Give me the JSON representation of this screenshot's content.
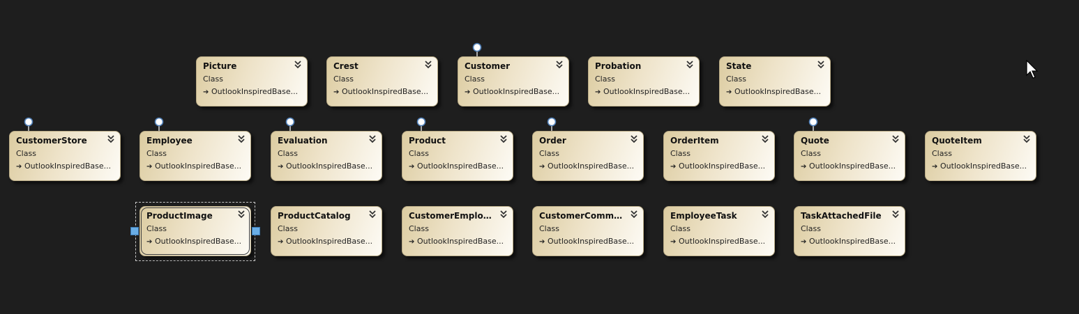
{
  "diagram": {
    "shapes": [
      {
        "name": "Picture",
        "kind": "Class",
        "base": "OutlookInspiredBase...",
        "lollipop": false
      },
      {
        "name": "Crest",
        "kind": "Class",
        "base": "OutlookInspiredBase...",
        "lollipop": false
      },
      {
        "name": "Customer",
        "kind": "Class",
        "base": "OutlookInspiredBase...",
        "lollipop": true
      },
      {
        "name": "Probation",
        "kind": "Class",
        "base": "OutlookInspiredBase...",
        "lollipop": false
      },
      {
        "name": "State",
        "kind": "Class",
        "base": "OutlookInspiredBase...",
        "lollipop": false
      },
      {
        "name": "CustomerStore",
        "kind": "Class",
        "base": "OutlookInspiredBase...",
        "lollipop": true
      },
      {
        "name": "Employee",
        "kind": "Class",
        "base": "OutlookInspiredBase...",
        "lollipop": true
      },
      {
        "name": "Evaluation",
        "kind": "Class",
        "base": "OutlookInspiredBase...",
        "lollipop": true
      },
      {
        "name": "Product",
        "kind": "Class",
        "base": "OutlookInspiredBase...",
        "lollipop": true
      },
      {
        "name": "Order",
        "kind": "Class",
        "base": "OutlookInspiredBase...",
        "lollipop": true
      },
      {
        "name": "OrderItem",
        "kind": "Class",
        "base": "OutlookInspiredBase...",
        "lollipop": false
      },
      {
        "name": "Quote",
        "kind": "Class",
        "base": "OutlookInspiredBase...",
        "lollipop": true
      },
      {
        "name": "QuoteItem",
        "kind": "Class",
        "base": "OutlookInspiredBase...",
        "lollipop": false
      },
      {
        "name": "ProductImage",
        "kind": "Class",
        "base": "OutlookInspiredBase...",
        "lollipop": false,
        "selected": true
      },
      {
        "name": "ProductCatalog",
        "kind": "Class",
        "base": "OutlookInspiredBase...",
        "lollipop": false
      },
      {
        "name": "CustomerEmplo...",
        "kind": "Class",
        "base": "OutlookInspiredBase...",
        "lollipop": false
      },
      {
        "name": "CustomerComm...",
        "kind": "Class",
        "base": "OutlookInspiredBase...",
        "lollipop": false
      },
      {
        "name": "EmployeeTask",
        "kind": "Class",
        "base": "OutlookInspiredBase...",
        "lollipop": false
      },
      {
        "name": "TaskAttachedFile",
        "kind": "Class",
        "base": "OutlookInspiredBase...",
        "lollipop": false
      }
    ]
  },
  "colors": {
    "background": "#1e1e1e",
    "selection_handle": "#6aaee6"
  },
  "icons": {
    "collapse": "double-chevron-down-icon",
    "inheritance": "inheritance-arrow-icon",
    "interface": "interface-lollipop-icon",
    "cursor": "mouse-pointer-icon"
  }
}
